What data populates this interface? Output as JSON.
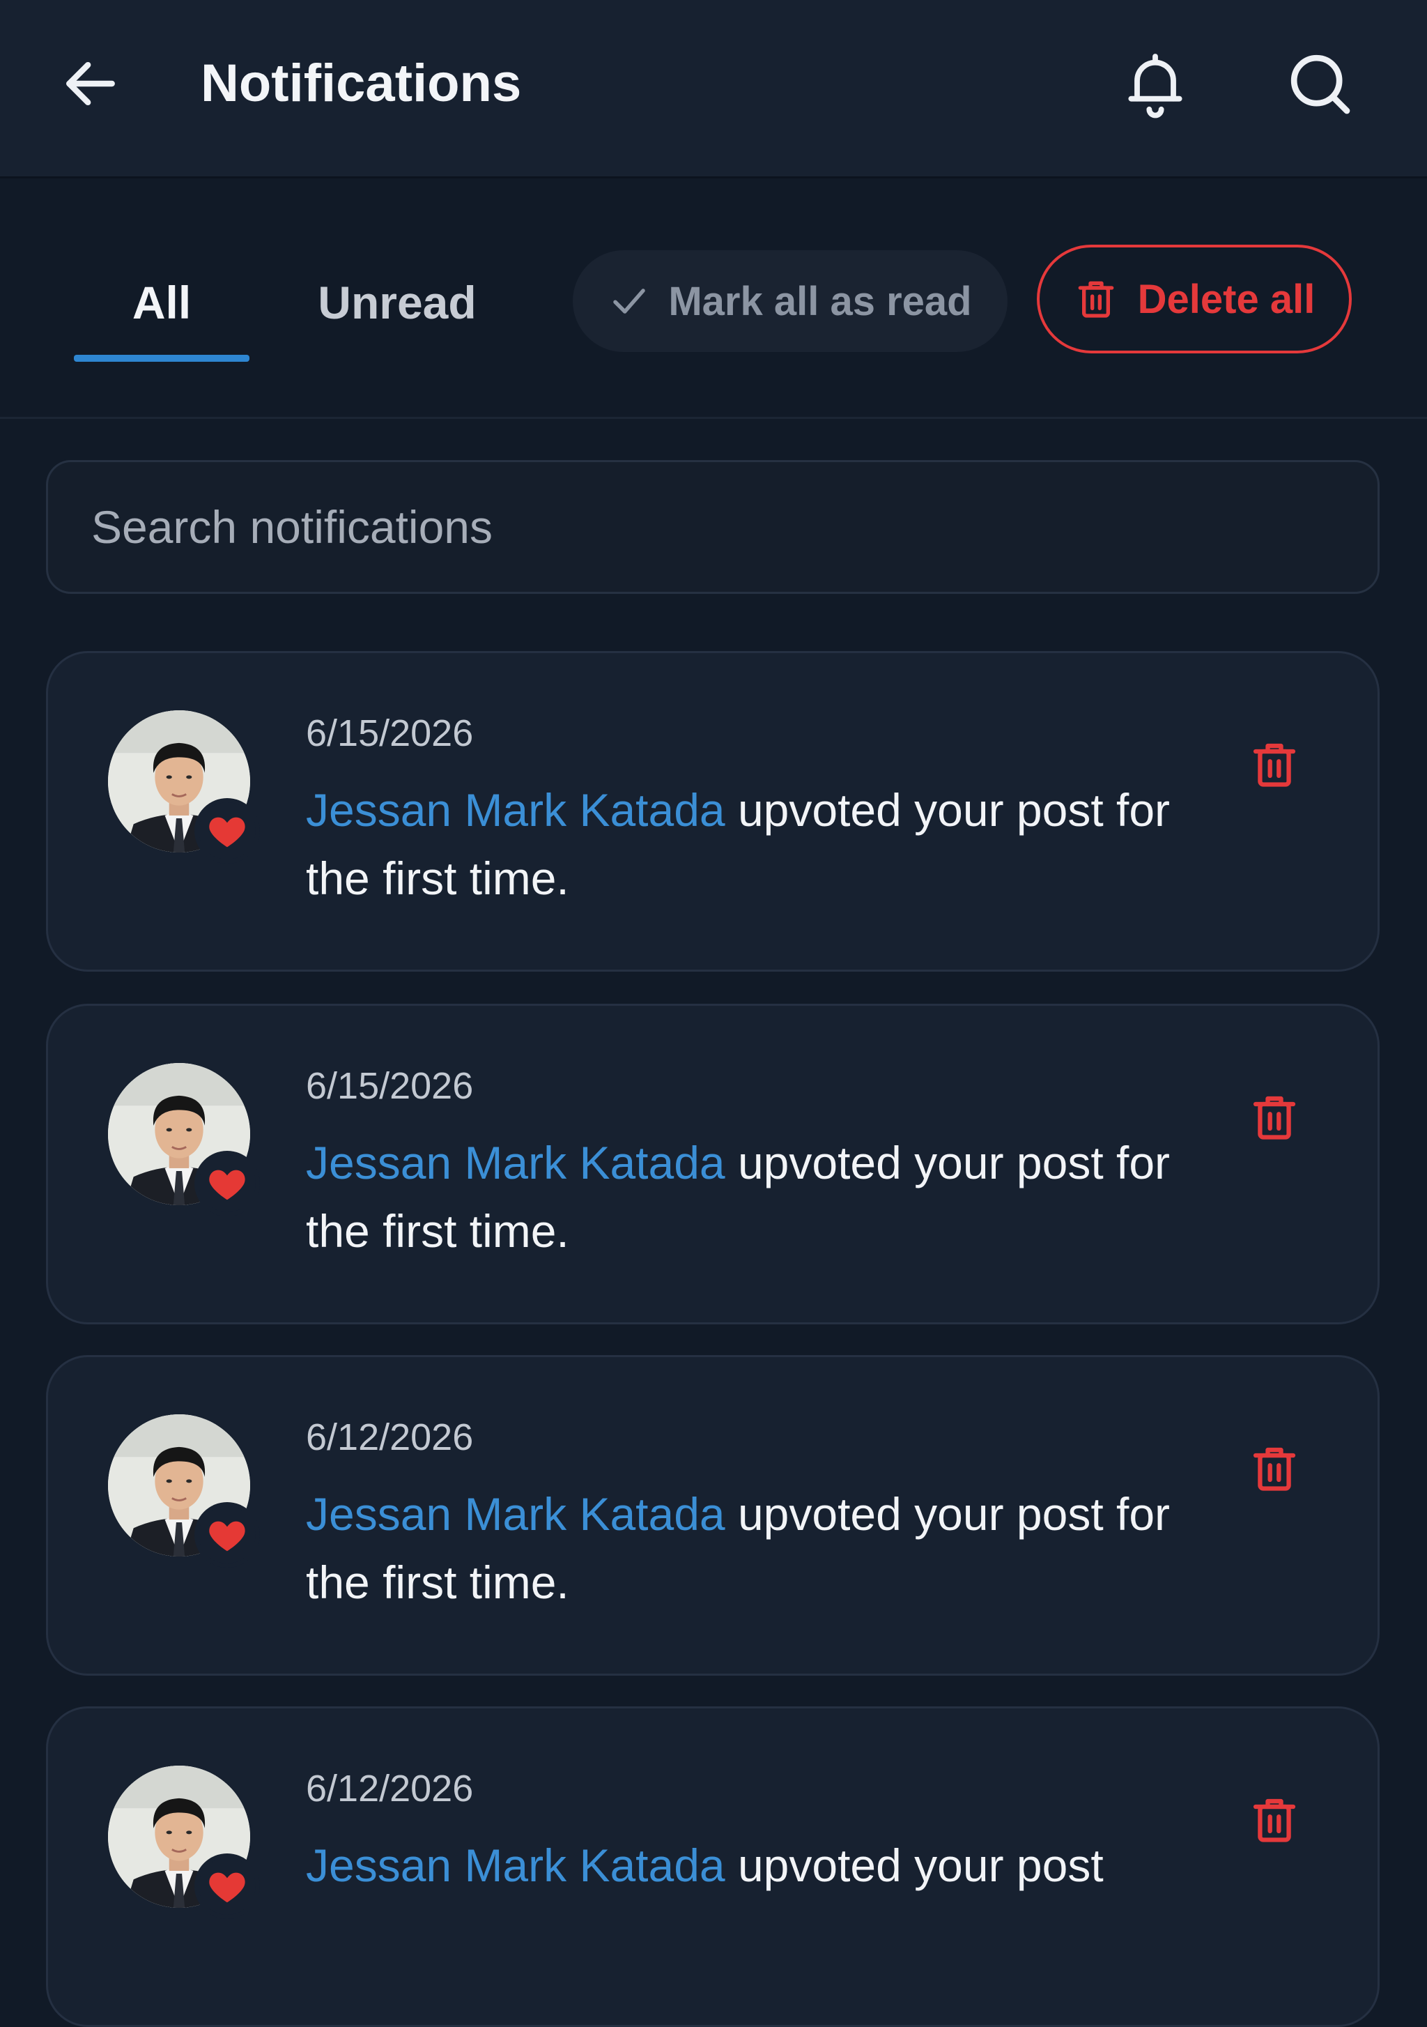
{
  "header": {
    "title": "Notifications",
    "back_icon": "arrow-left-icon",
    "bell_icon": "bell-icon",
    "search_icon": "search-icon"
  },
  "tabs": [
    {
      "label": "All",
      "selected": true
    },
    {
      "label": "Unread",
      "selected": false
    }
  ],
  "actions": {
    "mark_all_read": "Mark all as read",
    "delete_all": "Delete all"
  },
  "search": {
    "placeholder": "Search notifications",
    "value": ""
  },
  "notifications": [
    {
      "date": "6/15/2026",
      "actor": "Jessan Mark Katada",
      "action": " upvoted your post for the first time.",
      "badge_icon": "heart-icon"
    },
    {
      "date": "6/15/2026",
      "actor": "Jessan Mark Katada",
      "action": " upvoted your post for the first time.",
      "badge_icon": "heart-icon"
    },
    {
      "date": "6/12/2026",
      "actor": "Jessan Mark Katada",
      "action": " upvoted your post for the first time.",
      "badge_icon": "heart-icon"
    },
    {
      "date": "6/12/2026",
      "actor": "Jessan Mark Katada",
      "action": " upvoted your post",
      "badge_icon": "heart-icon"
    }
  ],
  "colors": {
    "background": "#111a27",
    "accent": "#2e86d1",
    "danger": "#e5393b",
    "actor_link": "#3b8fd6"
  }
}
